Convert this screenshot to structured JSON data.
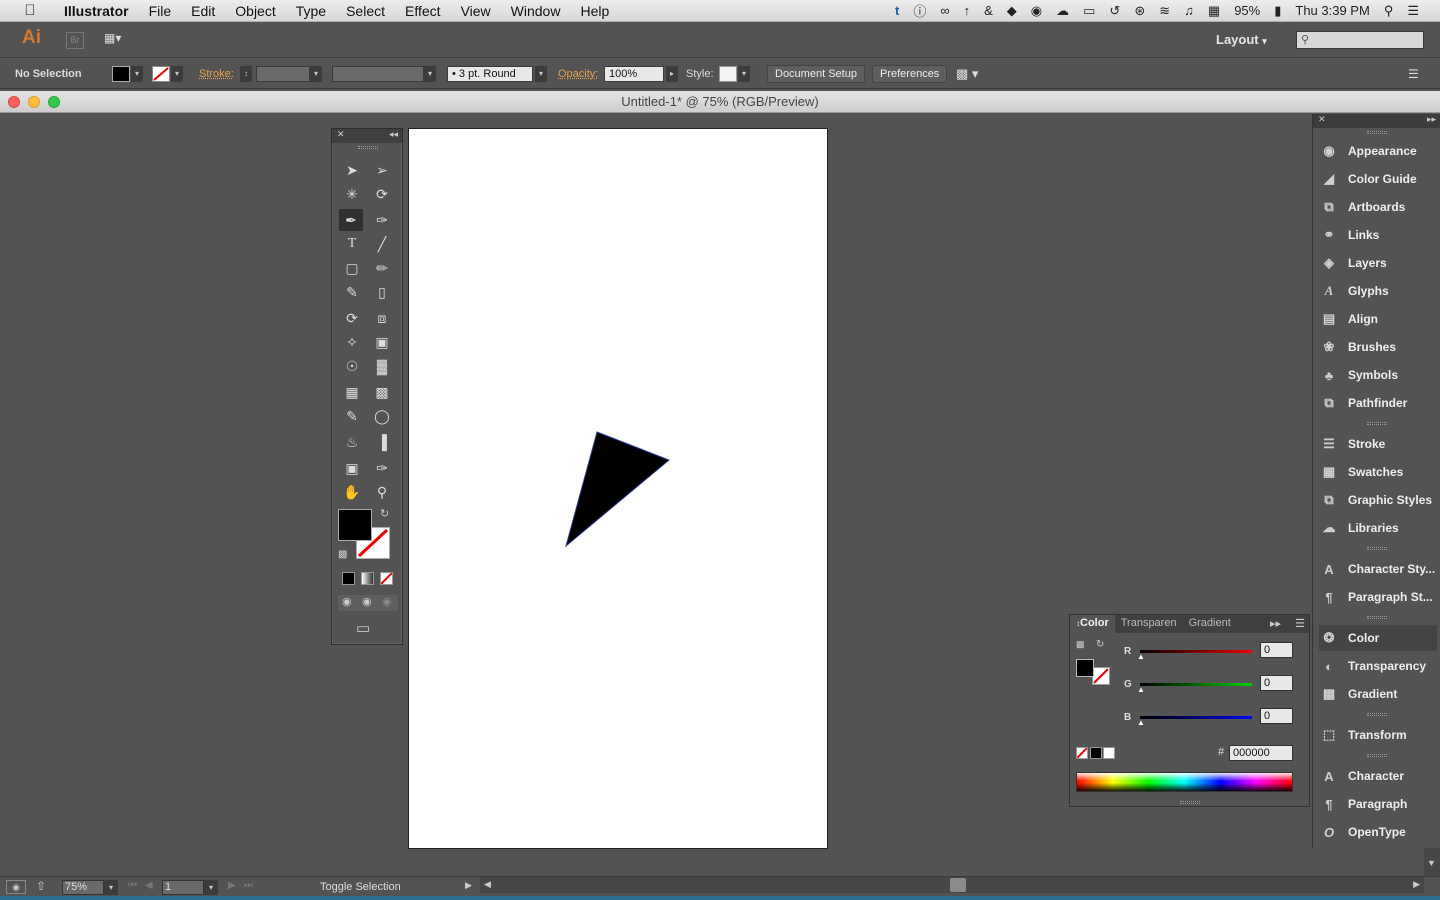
{
  "menubar": {
    "app_name": "Illustrator",
    "items": [
      "File",
      "Edit",
      "Object",
      "Type",
      "Select",
      "Effect",
      "View",
      "Window",
      "Help"
    ],
    "battery": "95%",
    "clock": "Thu 3:39 PM"
  },
  "appbar": {
    "logo": "Ai",
    "bridge": "Br",
    "layout_label": "Layout"
  },
  "control": {
    "selection": "No Selection",
    "stroke_label": "Stroke:",
    "brush": "3 pt. Round",
    "opacity_label": "Opacity:",
    "opacity_value": "100%",
    "style_label": "Style:",
    "document_setup": "Document Setup",
    "preferences": "Preferences"
  },
  "document": {
    "title": "Untitled-1* @ 75% (RGB/Preview)"
  },
  "right_panel": {
    "groups": [
      [
        "Appearance",
        "Color Guide",
        "Artboards",
        "Links",
        "Layers",
        "Glyphs",
        "Align",
        "Brushes",
        "Symbols",
        "Pathfinder"
      ],
      [
        "Stroke",
        "Swatches",
        "Graphic Styles",
        "Libraries"
      ],
      [
        "Character Sty...",
        "Paragraph St..."
      ],
      [
        "Color",
        "Transparency",
        "Gradient"
      ],
      [
        "Transform"
      ],
      [
        "Character",
        "Paragraph",
        "OpenType"
      ]
    ]
  },
  "color_panel": {
    "tabs": [
      "Color",
      "Transparen",
      "Gradient"
    ],
    "r_label": "R",
    "g_label": "G",
    "b_label": "B",
    "r": "0",
    "g": "0",
    "b": "0",
    "hash": "#",
    "hex": "000000"
  },
  "status": {
    "zoom": "75%",
    "page": "1",
    "toggle": "Toggle Selection"
  },
  "colors": {
    "accent_orange": "#d47a33",
    "artboard": "#ffffff",
    "ui_bg": "#535353"
  }
}
